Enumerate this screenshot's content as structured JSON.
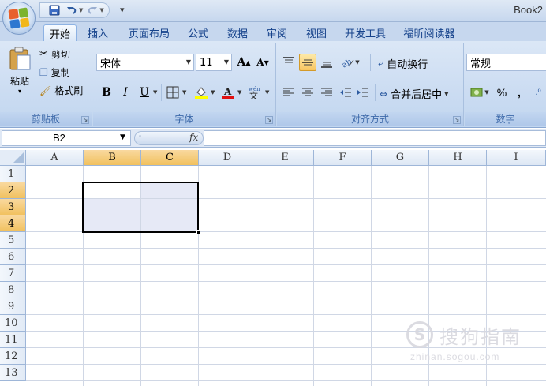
{
  "app": {
    "title": "Book2"
  },
  "quick_access": {
    "save_icon": "save-icon",
    "undo_icon": "undo-icon",
    "redo_icon": "redo-icon",
    "customize_glyph": "₹"
  },
  "tabs": [
    {
      "label": "开始",
      "active": true
    },
    {
      "label": "插入"
    },
    {
      "label": "页面布局"
    },
    {
      "label": "公式"
    },
    {
      "label": "数据"
    },
    {
      "label": "审阅"
    },
    {
      "label": "视图"
    },
    {
      "label": "开发工具"
    },
    {
      "label": "福昕阅读器"
    }
  ],
  "ribbon": {
    "clipboard": {
      "paste": "粘贴",
      "cut": "剪切",
      "copy": "复制",
      "format_painter": "格式刷",
      "group_label": "剪贴板"
    },
    "font": {
      "font_name": "宋体",
      "font_size": "11",
      "bold": "B",
      "italic": "I",
      "underline": "U",
      "grow": "A",
      "shrink": "A",
      "group_label": "字体"
    },
    "alignment": {
      "wrap_text": "自动换行",
      "merge_center": "合并后居中",
      "group_label": "对齐方式"
    },
    "number": {
      "format": "常规",
      "percent": "%",
      "comma": ",",
      "group_label": "数字"
    }
  },
  "formula_bar": {
    "name_box": "B2",
    "fx": "fx",
    "formula": ""
  },
  "grid": {
    "columns": [
      "A",
      "B",
      "C",
      "D",
      "E",
      "F",
      "G",
      "H",
      "I"
    ],
    "rows": [
      "1",
      "2",
      "3",
      "4",
      "5",
      "6",
      "7",
      "8",
      "9",
      "10",
      "11",
      "12",
      "13"
    ],
    "selected_columns": [
      "B",
      "C"
    ],
    "selected_rows": [
      "2",
      "3",
      "4"
    ],
    "active_cell": "B2",
    "selection_range": "B2:C4"
  },
  "watermark": {
    "logo_glyph": "S",
    "text": "搜狗指南",
    "url": "zhinan.sogou.com"
  },
  "colors": {
    "ribbon_bg": "#cbdcf2",
    "selected_header": "#f1c15f",
    "selection_fill": "#e6e9f6",
    "gridline": "#d0d7e5"
  }
}
